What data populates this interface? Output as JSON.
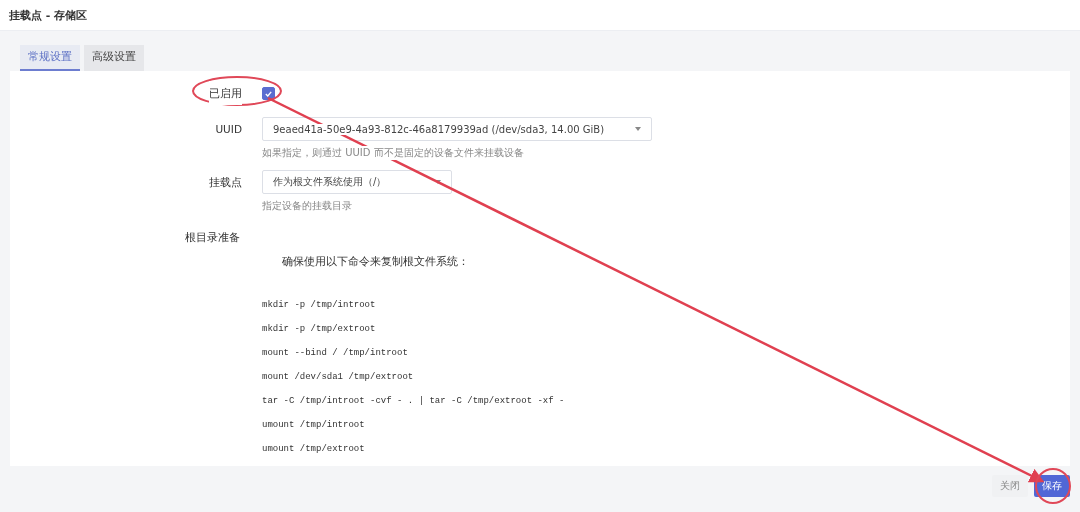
{
  "page_title": "挂载点 - 存储区",
  "tabs": [
    {
      "label": "常规设置",
      "selected": true
    },
    {
      "label": "高级设置",
      "selected": false
    }
  ],
  "form": {
    "enabled": {
      "label": "已启用",
      "checked": true
    },
    "uuid": {
      "label": "UUID",
      "value": "9eaed41a-50e9-4a93-812c-46a8179939ad (/dev/sda3, 14.00 GiB)",
      "hint": "如果指定，则通过 UUID 而不是固定的设备文件来挂载设备"
    },
    "mount_point": {
      "label": "挂载点",
      "value": "作为根文件系统使用（/）",
      "hint": "指定设备的挂载目录"
    },
    "root_prep": {
      "label": "根目录准备",
      "intro": "确保使用以下命令来复制根文件系统：",
      "commands": [
        "mkdir -p /tmp/introot",
        "mkdir -p /tmp/extroot",
        "mount --bind / /tmp/introot",
        "mount /dev/sda1 /tmp/extroot",
        "tar -C /tmp/introot -cvf - . | tar -C /tmp/extroot -xf -",
        "umount /tmp/introot",
        "umount /tmp/extroot"
      ]
    }
  },
  "buttons": [
    {
      "label": "关闭",
      "kind": "secondary"
    },
    {
      "label": "保存",
      "kind": "primary"
    }
  ]
}
